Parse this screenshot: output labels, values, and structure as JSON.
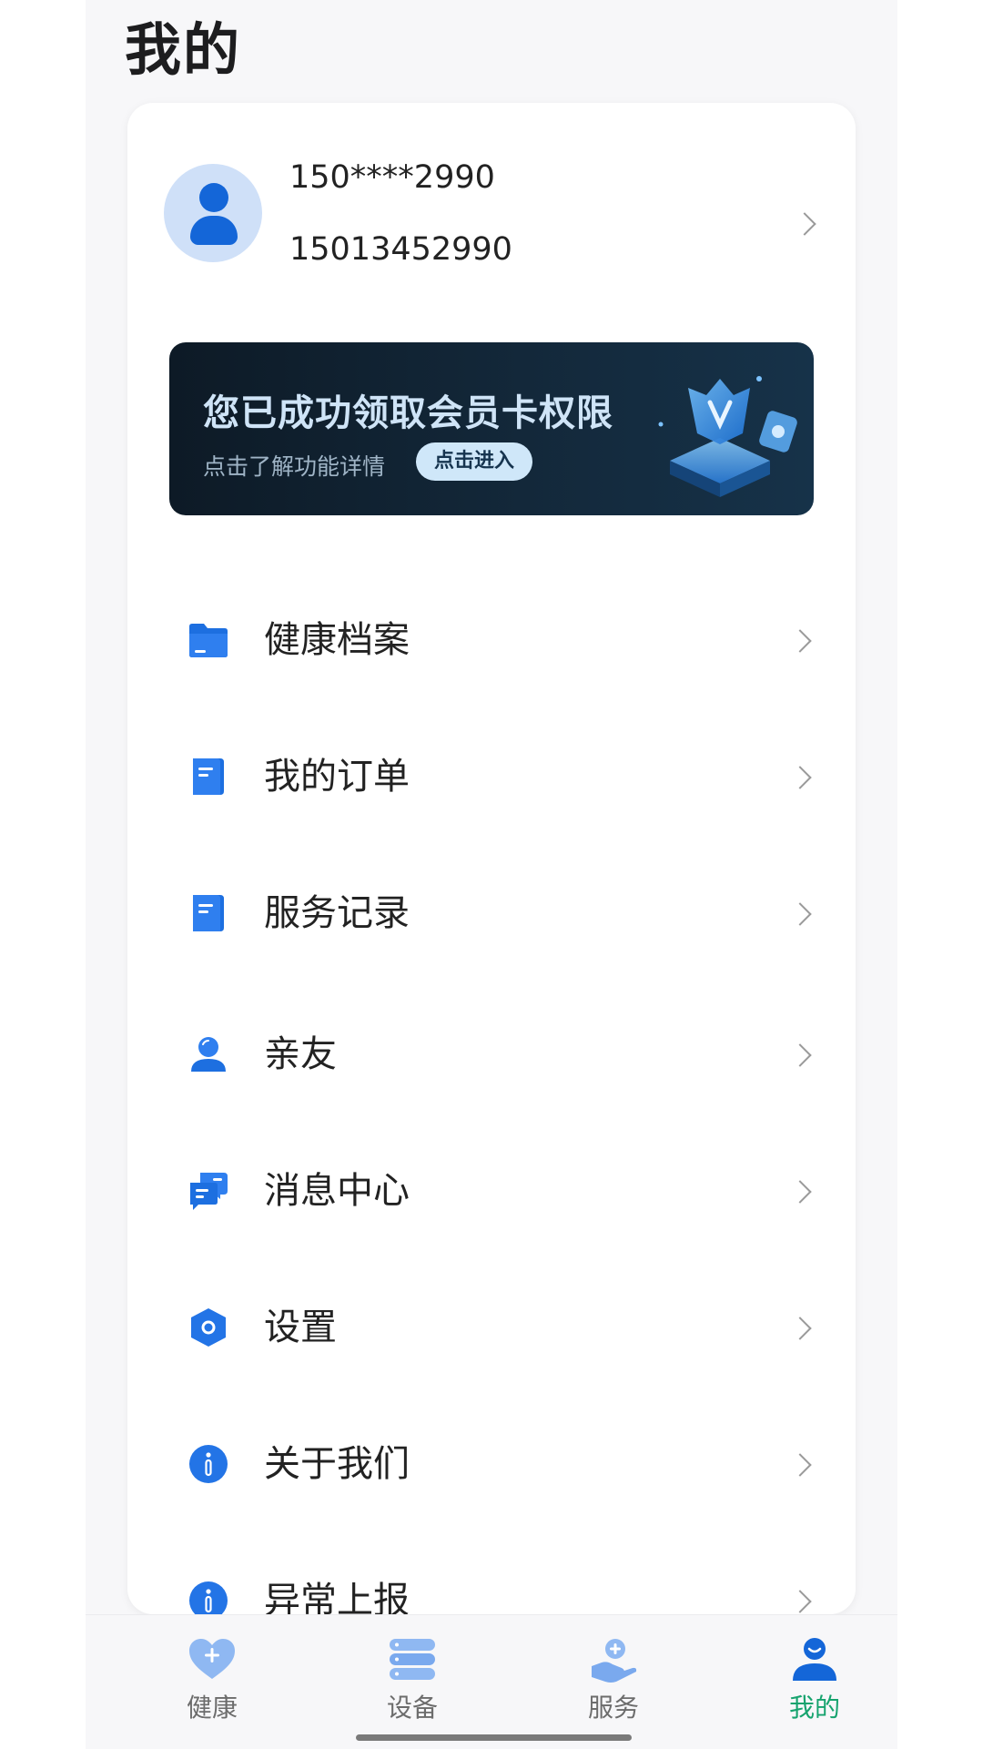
{
  "header": {
    "title": "我的"
  },
  "profile": {
    "masked_number": "150****2990",
    "phone_number": "15013452990",
    "avatar_icon": "user-avatar-icon"
  },
  "banner": {
    "title": "您已成功领取会员卡权限",
    "subtitle": "点击了解功能详情",
    "button_label": "点击进入"
  },
  "menu": {
    "items": [
      {
        "label": "健康档案",
        "icon": "folder-icon"
      },
      {
        "label": "我的订单",
        "icon": "document-icon"
      },
      {
        "label": "服务记录",
        "icon": "document-icon"
      },
      {
        "label": "亲友",
        "icon": "person-icon"
      },
      {
        "label": "消息中心",
        "icon": "chat-bubbles-icon"
      },
      {
        "label": "设置",
        "icon": "gear-hexagon-icon"
      },
      {
        "label": "关于我们",
        "icon": "info-icon"
      },
      {
        "label": "异常上报",
        "icon": "info-icon"
      }
    ]
  },
  "tabbar": {
    "items": [
      {
        "label": "健康",
        "icon": "heart-plus-icon",
        "active": false
      },
      {
        "label": "设备",
        "icon": "device-stack-icon",
        "active": false
      },
      {
        "label": "服务",
        "icon": "care-hand-icon",
        "active": false
      },
      {
        "label": "我的",
        "icon": "user-icon",
        "active": true
      }
    ]
  },
  "colors": {
    "accent": "#1466d8",
    "active_tab": "#16a36e",
    "page_background": "#f7f7f9",
    "card_background": "#ffffff",
    "banner_background": "#13283a"
  }
}
